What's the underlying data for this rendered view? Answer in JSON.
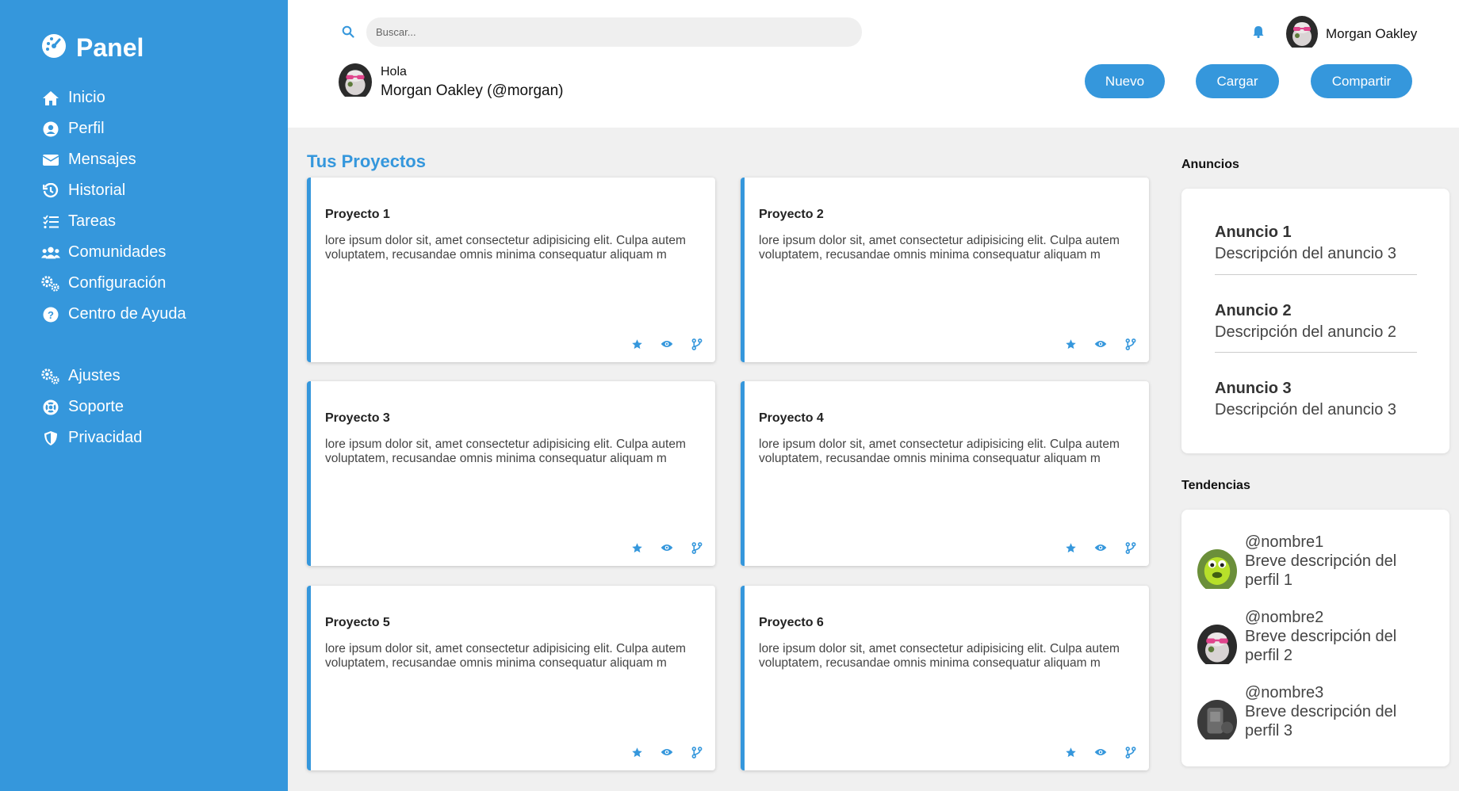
{
  "brand": {
    "label": "Panel",
    "icon": "dashboard-gauge-icon"
  },
  "colors": {
    "accent": "#3597dc",
    "background": "#f0f0f0"
  },
  "nav_primary": [
    {
      "label": "Inicio",
      "icon": "home-icon"
    },
    {
      "label": "Perfil",
      "icon": "user-circle-icon"
    },
    {
      "label": "Mensajes",
      "icon": "envelope-icon"
    },
    {
      "label": "Historial",
      "icon": "history-icon"
    },
    {
      "label": "Tareas",
      "icon": "tasks-icon"
    },
    {
      "label": "Comunidades",
      "icon": "users-icon"
    },
    {
      "label": "Configuración",
      "icon": "gears-icon"
    },
    {
      "label": "Centro de Ayuda",
      "icon": "question-circle-icon"
    }
  ],
  "nav_secondary": [
    {
      "label": "Ajustes",
      "icon": "gears-icon"
    },
    {
      "label": "Soporte",
      "icon": "life-ring-icon"
    },
    {
      "label": "Privacidad",
      "icon": "shield-icon"
    }
  ],
  "search": {
    "placeholder": "Buscar..."
  },
  "header": {
    "user_name": "Morgan Oakley",
    "greeting": "Hola",
    "greeting_name": "Morgan Oakley (@morgan)",
    "buttons": {
      "new": "Nuevo",
      "load": "Cargar",
      "share": "Compartir"
    }
  },
  "projects": {
    "title": "Tus Proyectos",
    "items": [
      {
        "title": "Proyecto 1",
        "desc": "lore ipsum dolor sit, amet consectetur adipisicing elit. Culpa autem voluptatem, recusandae omnis minima consequatur aliquam m"
      },
      {
        "title": "Proyecto 2",
        "desc": "lore ipsum dolor sit, amet consectetur adipisicing elit. Culpa autem voluptatem, recusandae omnis minima consequatur aliquam m"
      },
      {
        "title": "Proyecto 3",
        "desc": "lore ipsum dolor sit, amet consectetur adipisicing elit. Culpa autem voluptatem, recusandae omnis minima consequatur aliquam m"
      },
      {
        "title": "Proyecto 4",
        "desc": "lore ipsum dolor sit, amet consectetur adipisicing elit. Culpa autem voluptatem, recusandae omnis minima consequatur aliquam m"
      },
      {
        "title": "Proyecto 5",
        "desc": "lore ipsum dolor sit, amet consectetur adipisicing elit. Culpa autem voluptatem, recusandae omnis minima consequatur aliquam m"
      },
      {
        "title": "Proyecto 6",
        "desc": "lore ipsum dolor sit, amet consectetur adipisicing elit. Culpa autem voluptatem, recusandae omnis minima consequatur aliquam m"
      }
    ]
  },
  "announcements": {
    "title": "Anuncios",
    "items": [
      {
        "title": "Anuncio 1",
        "desc": "Descripción del anuncio 3"
      },
      {
        "title": "Anuncio 2",
        "desc": "Descripción del anuncio 2"
      },
      {
        "title": "Anuncio 3",
        "desc": "Descripción del anuncio 3"
      }
    ]
  },
  "trends": {
    "title": "Tendencias",
    "items": [
      {
        "handle": "@nombre1",
        "desc": "Breve descripción del perfil 1"
      },
      {
        "handle": "@nombre2",
        "desc": "Breve descripción del perfil 2"
      },
      {
        "handle": "@nombre3",
        "desc": "Breve descripción del perfil 3"
      }
    ]
  }
}
